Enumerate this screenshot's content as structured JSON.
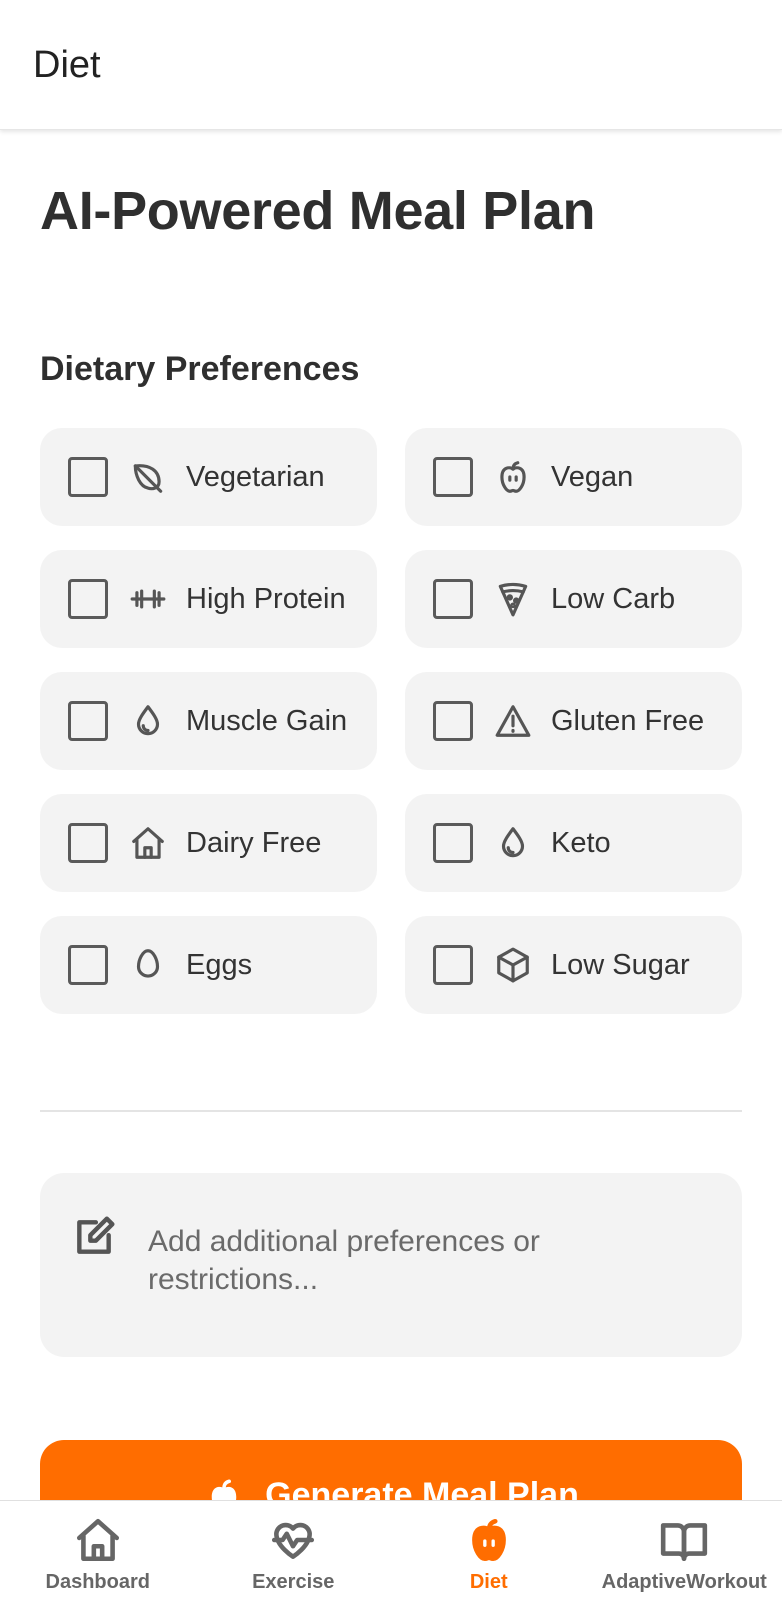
{
  "appbar": {
    "title": "Diet"
  },
  "page": {
    "title": "AI-Powered Meal Plan",
    "section_title": "Dietary Preferences"
  },
  "preferences": [
    {
      "label": "Vegetarian",
      "icon": "leaf-icon",
      "checked": false
    },
    {
      "label": "Vegan",
      "icon": "apple-icon",
      "checked": false
    },
    {
      "label": "High Protein",
      "icon": "dumbbell-icon",
      "checked": false
    },
    {
      "label": "Low Carb",
      "icon": "pizza-icon",
      "checked": false
    },
    {
      "label": "Muscle Gain",
      "icon": "droplet-icon",
      "checked": false
    },
    {
      "label": "Gluten Free",
      "icon": "warning-icon",
      "checked": false
    },
    {
      "label": "Dairy Free",
      "icon": "home-icon",
      "checked": false
    },
    {
      "label": "Keto",
      "icon": "droplet-icon",
      "checked": false
    },
    {
      "label": "Eggs",
      "icon": "egg-icon",
      "checked": false
    },
    {
      "label": "Low Sugar",
      "icon": "cube-icon",
      "checked": false
    }
  ],
  "notes": {
    "placeholder": "Add additional preferences or restrictions..."
  },
  "generate_button": {
    "label": "Generate Meal Plan"
  },
  "bottom_nav": [
    {
      "label": "Dashboard",
      "icon": "home-icon",
      "active": false
    },
    {
      "label": "Exercise",
      "icon": "heart-pulse-icon",
      "active": false
    },
    {
      "label": "Diet",
      "icon": "apple-icon",
      "active": true
    },
    {
      "label": "AdaptiveWorkout",
      "icon": "book-open-icon",
      "active": false
    }
  ],
  "colors": {
    "accent": "#ff6d00",
    "card": "#f3f3f3",
    "text": "#2f2f2f"
  }
}
